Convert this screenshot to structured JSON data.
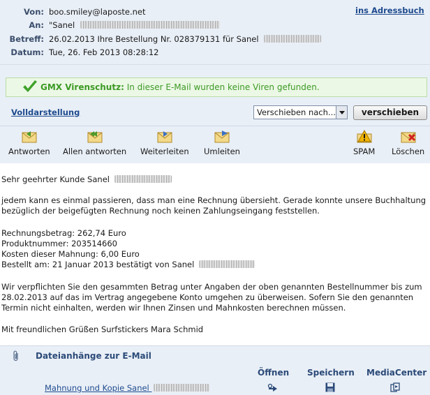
{
  "header": {
    "from_label": "Von:",
    "from_value": "boo.smiley@laposte.net",
    "to_label": "An:",
    "to_value": "\"Sanel",
    "subject_label": "Betreff:",
    "subject_value": "26.02.2013 Ihre Bestellung Nr. 028379131 für Sanel",
    "date_label": "Datum:",
    "date_value": "Tue, 26. Feb 2013 08:28:12",
    "address_book_link": "ins Adressbuch"
  },
  "virus": {
    "title": "GMX Virenschutz:",
    "message": "In dieser E-Mail wurden keine Viren gefunden."
  },
  "actions": {
    "full_view_link": "Volldarstellung",
    "move_select_value": "Verschieben nach...",
    "move_button": "verschieben"
  },
  "toolbar": {
    "reply": "Antworten",
    "reply_all": "Allen antworten",
    "forward": "Weiterleiten",
    "redirect": "Umleiten",
    "spam": "SPAM",
    "delete": "Löschen"
  },
  "body": {
    "greeting": "Sehr geehrter Kunde Sanel",
    "p1_line1": "jedem kann es einmal passieren, dass man eine Rechnung übersieht. Gerade konnte unsere Buchhaltung",
    "p1_line2": "bezüglich der beigefügten Rechnung noch keinen Zahlungseingang feststellen.",
    "amount": "Rechnungsbetrag: 262,74 Euro",
    "product": "Produktnummer: 203514660",
    "fee": "Kosten dieser Mahnung: 6,00 Euro",
    "ordered": "Bestellt am: 21 Januar 2013 bestätigt von Sanel",
    "p2_line1": "Wir verpflichten Sie den gesammten Betrag unter Angaben der oben genannten Bestellnummer bis zum",
    "p2_line2": "28.02.2013 auf das im Vertrag angegebene Konto umgehen zu überweisen. Sofern Sie den genannten",
    "p2_line3": "Termin nicht einhalten, werden wir Ihnen Zinsen und Mahnkosten berechnen müssen.",
    "closing": "Mit freundlichen Grüßen Surfstickers Mara Schmid"
  },
  "attachments": {
    "title": "Dateianhänge zur E-Mail",
    "col_open": "Öffnen",
    "col_save": "Speichern",
    "col_media": "MediaCenter",
    "file_name": "Mahnung und Kopie Sanel"
  },
  "colors": {
    "accent": "#1e4b8e",
    "header_bg": "#e9eff7",
    "virus_green": "#3c9a25"
  }
}
